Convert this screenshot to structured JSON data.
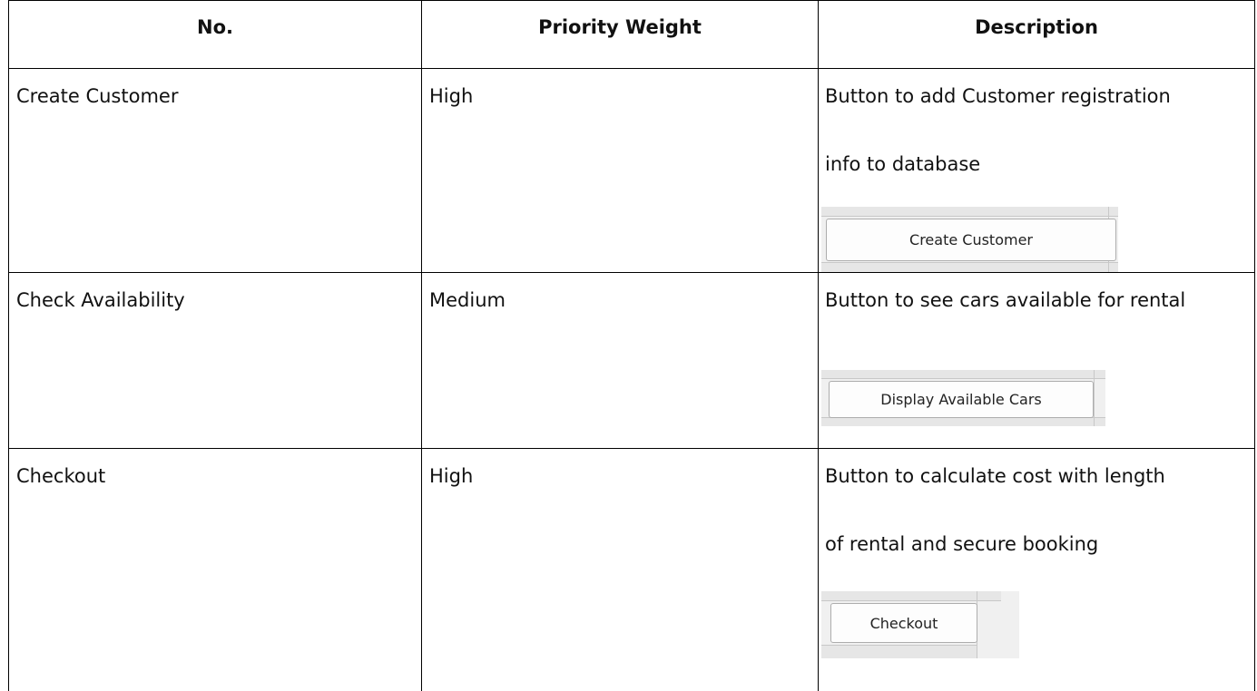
{
  "table": {
    "headers": [
      "No.",
      "Priority Weight",
      "Description"
    ],
    "rows": [
      {
        "name": "Create Customer",
        "priority": "High",
        "description_line1": "Button to add Customer registration",
        "description_line2": "info to database",
        "button_label": "Create Customer"
      },
      {
        "name": "Check Availability",
        "priority": "Medium",
        "description_line1": "Button to see cars available for rental",
        "button_label": "Display Available Cars"
      },
      {
        "name": "Checkout",
        "priority": "High",
        "description_line1": "Button to calculate cost with length",
        "description_line2": "of rental and secure booking",
        "button_label": "Checkout"
      }
    ]
  },
  "colors": {
    "grid": "#000000",
    "text": "#111111",
    "thumbnail_bg": "#f0f0f0"
  }
}
